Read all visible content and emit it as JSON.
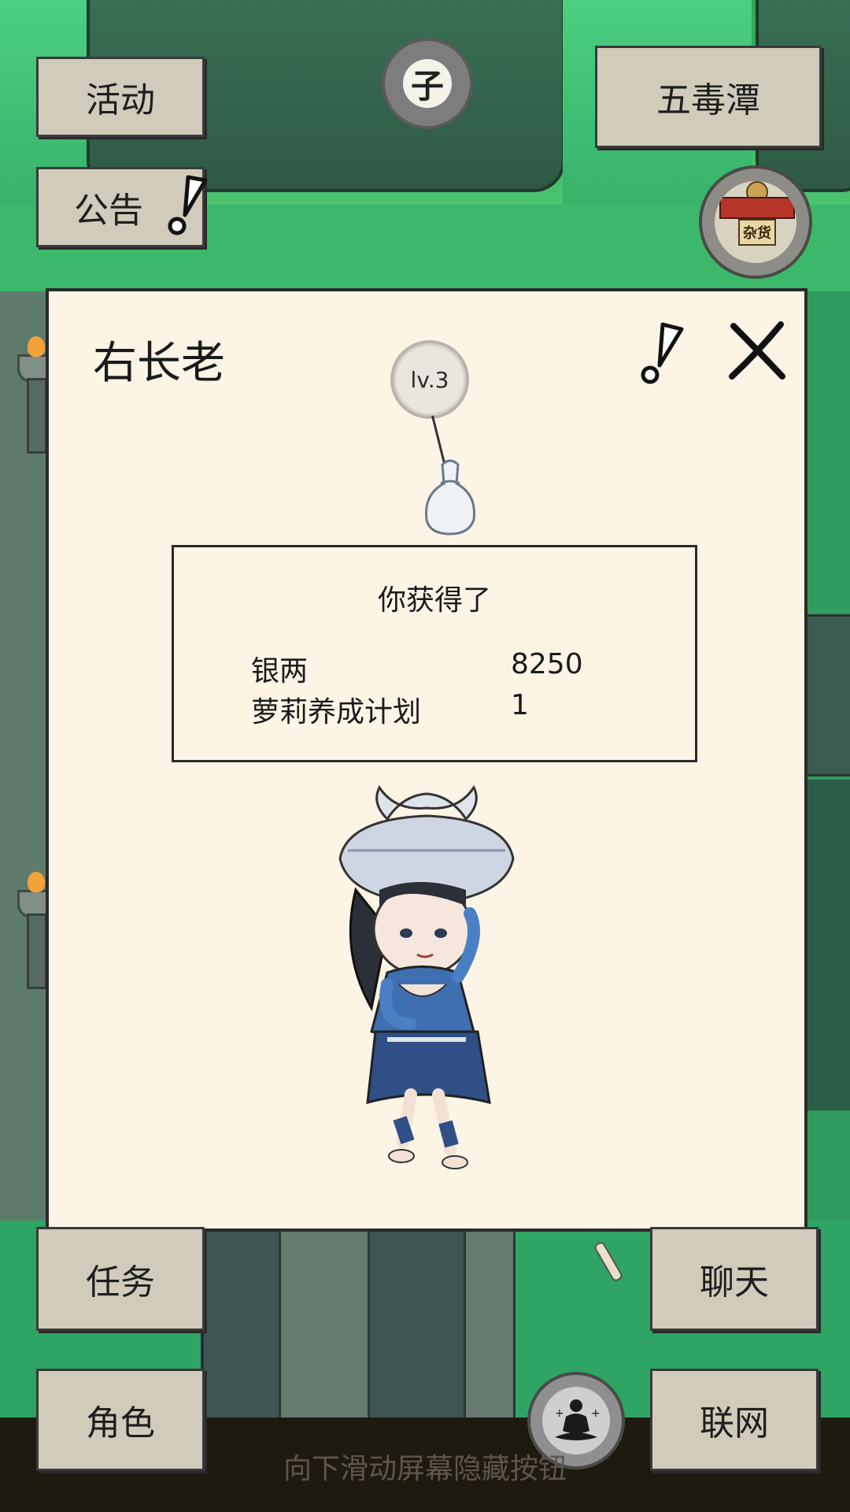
{
  "top_left": {
    "activity_label": "活动",
    "notice_label": "公告"
  },
  "time_indicator": {
    "glyph": "子"
  },
  "location": {
    "name": "五毒潭"
  },
  "shop": {
    "sign": "杂货"
  },
  "dialog": {
    "title": "右长老",
    "level_badge": "lv.3",
    "reward": {
      "heading": "你获得了",
      "items": [
        {
          "name": "银两",
          "quantity": "8250"
        },
        {
          "name": "萝莉养成计划",
          "quantity": "1"
        }
      ]
    }
  },
  "bottom_nav": {
    "task_label": "任务",
    "chat_label": "聊天",
    "role_label": "角色",
    "network_label": "联网"
  },
  "hint": {
    "text": "向下滑动屏幕隐藏按钮"
  }
}
